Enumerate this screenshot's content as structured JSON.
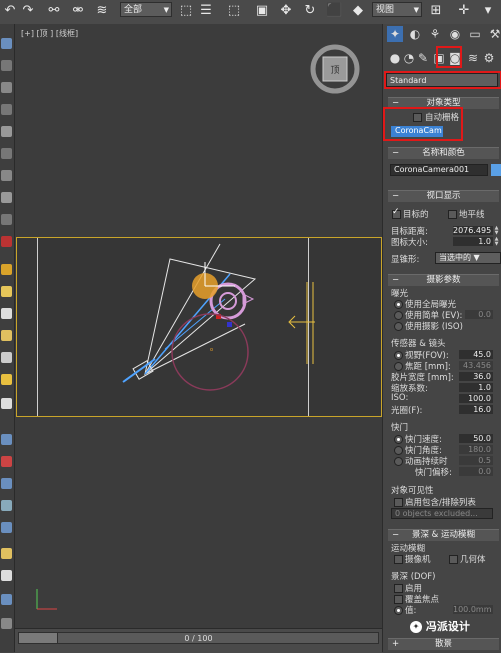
{
  "toolbar": {
    "selection_filter": "全部",
    "reference_coord": "视图",
    "icons": [
      "undo-icon",
      "redo-icon",
      "link-icon",
      "unlink-icon",
      "bind-space-warp-icon",
      "select-icon",
      "select-by-name-icon",
      "rect-select-icon",
      "window-crossing-icon",
      "move-icon",
      "rotate-icon",
      "scale-icon",
      "place-icon",
      "pivot-icon",
      "snap-icon"
    ]
  },
  "viewport": {
    "label_plus": "[+]",
    "label_view": "[顶 ]",
    "label_shading": "[线框]",
    "viewcube_label": "顶"
  },
  "timeline": {
    "position": "0 / 100",
    "progress": 0.0
  },
  "command_panel": {
    "tabs": [
      "create-tab",
      "modify-tab",
      "hierarchy-tab",
      "motion-tab",
      "display-tab",
      "utilities-tab"
    ],
    "category": "Standard",
    "object_type": {
      "title": "对象类型",
      "auto_grid_label": "自动栅格",
      "auto_grid_checked": false,
      "button": "CoronaCam"
    },
    "name_color": {
      "title": "名称和颜色",
      "name_value": "CoronaCamera001",
      "color": "#5aa0e6"
    },
    "viewport_display": {
      "title": "视口显示",
      "targeted_label": "目标的",
      "targeted_checked": true,
      "horizon_label": "地平线",
      "horizon_checked": false,
      "target_distance_label": "目标距离:",
      "target_distance_value": "2076.495",
      "icon_size_label": "图标大小:",
      "icon_size_value": "1.0",
      "show_cone_label": "显锥形:",
      "show_cone_value": "当选中的"
    },
    "photographic": {
      "title": "摄影参数",
      "exposure_label": "曝光",
      "use_global_exposure": "使用全局曝光",
      "use_simple_ev": "使用简单 (EV):",
      "ev_value": "0.0",
      "use_photographic_iso": "使用摄影 (ISO)",
      "sensor_lens_label": "传感器 & 镜头",
      "fov_label": "视野(FOV):",
      "fov_value": "45.0",
      "focal_length_label": "焦距 [mm]:",
      "focal_length_value": "43.456",
      "film_width_label": "胶片宽度 [mm]:",
      "film_width_value": "36.0",
      "zoom_label": "缩放系数:",
      "zoom_value": "1.0",
      "iso_label": "ISO:",
      "iso_value": "100.0",
      "fstop_label": "光圈(F):",
      "fstop_value": "16.0",
      "shutter_label": "快门",
      "shutter_speed_label": "快门速度:",
      "shutter_speed_value": "50.0",
      "shutter_angle_label": "快门角度:",
      "shutter_angle_value": "180.0",
      "motion_blur_duration_label": "动画持续时",
      "motion_blur_duration_value": "0.5",
      "shutter_offset_label": "快门偏移:",
      "shutter_offset_value": "0.0"
    },
    "visibility": {
      "title": "对象可见性",
      "include_exclude_label": "启用包含/排除列表",
      "objects_excluded": "0 objects excluded..."
    },
    "dof_mblur": {
      "title": "景深 & 运动模糊",
      "motion_blur_label": "运动模糊",
      "camera_label": "摄像机",
      "geometry_label": "几何体",
      "dof_label": "景深 (DOF)",
      "enable_label": "启用",
      "override_focus_label": "覆盖焦点",
      "value_label": "值:",
      "value_value": "100.0mm"
    },
    "bokeh_title": "散景"
  },
  "watermark": "冯派设计"
}
